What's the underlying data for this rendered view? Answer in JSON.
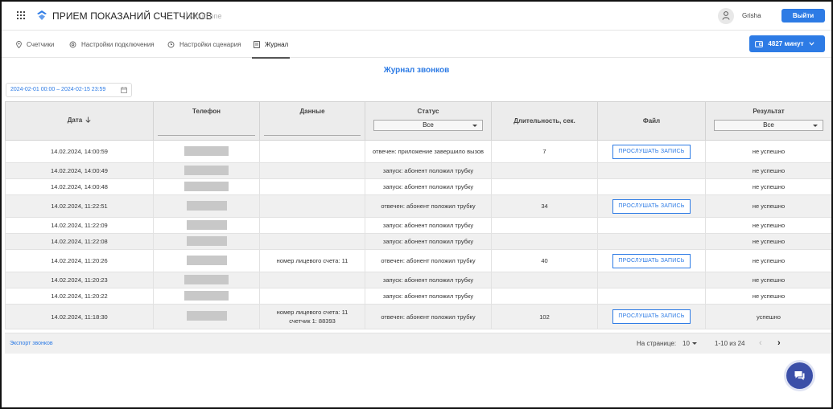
{
  "header": {
    "app_title": "ПРИЕМ ПОКАЗАНИЙ СЧЕТЧИКОВ",
    "brand": "Kloud.one",
    "username": "Grisha",
    "logout_label": "Выйти"
  },
  "tabs": [
    {
      "label": "Счетчики",
      "icon": "location-pin-icon"
    },
    {
      "label": "Настройки подключения",
      "icon": "gear-icon"
    },
    {
      "label": "Настройки сценария",
      "icon": "clock-icon"
    },
    {
      "label": "Журнал",
      "icon": "journal-icon",
      "active": true
    }
  ],
  "minutes_button": {
    "label": "4827 минут"
  },
  "page_title": "Журнал звонков",
  "date_range": "2024-02-01 00:00 – 2024-02-15 23:59",
  "table": {
    "columns": {
      "date": "Дата",
      "phone": "Телефон",
      "data": "Данные",
      "status": "Статус",
      "status_filter": "Все",
      "duration": "Длительность, сек.",
      "file": "Файл",
      "result": "Результат",
      "result_filter": "Все"
    },
    "listen_label": "ПРОСЛУШАТЬ ЗАПИСЬ",
    "rows": [
      {
        "date": "14.02.2024, 14:00:59",
        "data": "",
        "status": "отвечен: приложение завершило вызов",
        "duration": "7",
        "has_file": true,
        "result": "не успешно"
      },
      {
        "date": "14.02.2024, 14:00:49",
        "data": "",
        "status": "запуск: абонент положил трубку",
        "duration": "",
        "has_file": false,
        "result": "не успешно"
      },
      {
        "date": "14.02.2024, 14:00:48",
        "data": "",
        "status": "запуск: абонент положил трубку",
        "duration": "",
        "has_file": false,
        "result": "не успешно"
      },
      {
        "date": "14.02.2024, 11:22:51",
        "data": "",
        "status": "отвечен: абонент положил трубку",
        "duration": "34",
        "has_file": true,
        "result": "не успешно"
      },
      {
        "date": "14.02.2024, 11:22:09",
        "data": "",
        "status": "запуск: абонент положил трубку",
        "duration": "",
        "has_file": false,
        "result": "не успешно"
      },
      {
        "date": "14.02.2024, 11:22:08",
        "data": "",
        "status": "запуск: абонент положил трубку",
        "duration": "",
        "has_file": false,
        "result": "не успешно"
      },
      {
        "date": "14.02.2024, 11:20:26",
        "data": "номер лицевого счета: 11",
        "status": "отвечен: абонент положил трубку",
        "duration": "40",
        "has_file": true,
        "result": "не успешно"
      },
      {
        "date": "14.02.2024, 11:20:23",
        "data": "",
        "status": "запуск: абонент положил трубку",
        "duration": "",
        "has_file": false,
        "result": "не успешно"
      },
      {
        "date": "14.02.2024, 11:20:22",
        "data": "",
        "status": "запуск: абонент положил трубку",
        "duration": "",
        "has_file": false,
        "result": "не успешно"
      },
      {
        "date": "14.02.2024, 11:18:30",
        "data": "номер лицевого счета: 11",
        "data_line2": "счетчик 1: 88393",
        "status": "отвечен: абонент положил трубку",
        "duration": "102",
        "has_file": true,
        "result": "успешно"
      }
    ]
  },
  "footer": {
    "export_label": "Экспорт звонков",
    "per_page_label": "На странице:",
    "per_page_value": "10",
    "range_text": "1-10 из 24"
  },
  "colors": {
    "accent": "#2d7be5",
    "chat": "#3b4fa8"
  }
}
